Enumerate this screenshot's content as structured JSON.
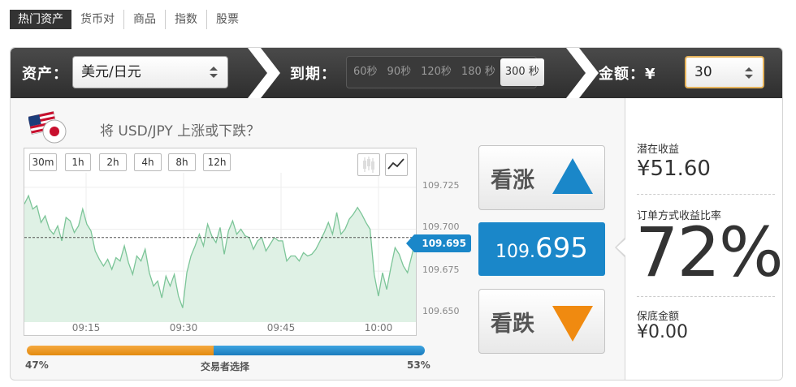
{
  "tabs": [
    "热门资产",
    "货币对",
    "商品",
    "指数",
    "股票"
  ],
  "bar": {
    "asset_label": "资产：",
    "asset_value": "美元/日元",
    "expiry_label": "到期：",
    "expiry_options": [
      "60秒",
      "90秒",
      "120秒",
      "180 秒",
      "300 秒"
    ],
    "amount_label": "金额：¥",
    "amount_value": "30"
  },
  "question": "将 USD/JPY 上涨或下跌？",
  "timeframes": [
    "30m",
    "1h",
    "2h",
    "4h",
    "8h",
    "12h"
  ],
  "chart_data": {
    "type": "area",
    "x_ticks": [
      "09:15",
      "09:30",
      "09:45",
      "10:00"
    ],
    "y_ticks": [
      "109.725",
      "109.700",
      "109.675",
      "109.650"
    ],
    "ylim": [
      109.6445,
      109.7298
    ],
    "current_price": "109.695",
    "series": [
      {
        "values": [
          109.715,
          109.72,
          109.712,
          109.714,
          109.704,
          109.708,
          109.7,
          109.697,
          109.702,
          109.693,
          109.707,
          109.705,
          109.698,
          109.702,
          109.712,
          109.703,
          109.699,
          109.687,
          109.682,
          109.678,
          109.682,
          109.676,
          109.683,
          109.681,
          109.69,
          109.68,
          109.673,
          109.684,
          109.681,
          109.688,
          109.674,
          109.666,
          109.669,
          109.659,
          109.672,
          109.666,
          109.673,
          109.66,
          109.653,
          109.674,
          109.684,
          109.69,
          109.697,
          109.69,
          109.703,
          109.696,
          109.692,
          109.701,
          109.685,
          109.699,
          109.705,
          109.697,
          109.7,
          109.696,
          109.695,
          109.688,
          109.693,
          109.695,
          109.687,
          109.691,
          109.695,
          109.693,
          109.693,
          109.681,
          109.684,
          109.684,
          109.681,
          109.686,
          109.684,
          109.685,
          109.688,
          109.693,
          109.698,
          109.704,
          109.697,
          109.71,
          109.697,
          109.7,
          109.706,
          109.709,
          109.713,
          109.709,
          109.704,
          109.7,
          109.673,
          109.66,
          109.674,
          109.664,
          109.677,
          109.689,
          109.685,
          109.678,
          109.674,
          109.684,
          109.695
        ]
      }
    ]
  },
  "up_label": "看涨",
  "down_label": "看跌",
  "price": {
    "small": "109.",
    "big": "695"
  },
  "sentiment": {
    "left": "47%",
    "center": "交易者选择",
    "right": "53%",
    "left_fraction": 0.47
  },
  "right_panel": {
    "profit_label": "潜在收益",
    "profit_value": "¥51.60",
    "rate_label": "订单方式收益比率",
    "rate_value": "72%",
    "guarantee_label": "保底金额",
    "guarantee_value": "¥0.00"
  },
  "colors": {
    "call": "#1a87c9",
    "put": "#f08a10",
    "area_line": "#7cc598",
    "area_fill": "#dff1e5"
  },
  "icons": [
    "us-japan-flag-icon",
    "candlestick-chart-icon",
    "line-chart-icon",
    "triangle-up-icon",
    "triangle-down-icon"
  ]
}
